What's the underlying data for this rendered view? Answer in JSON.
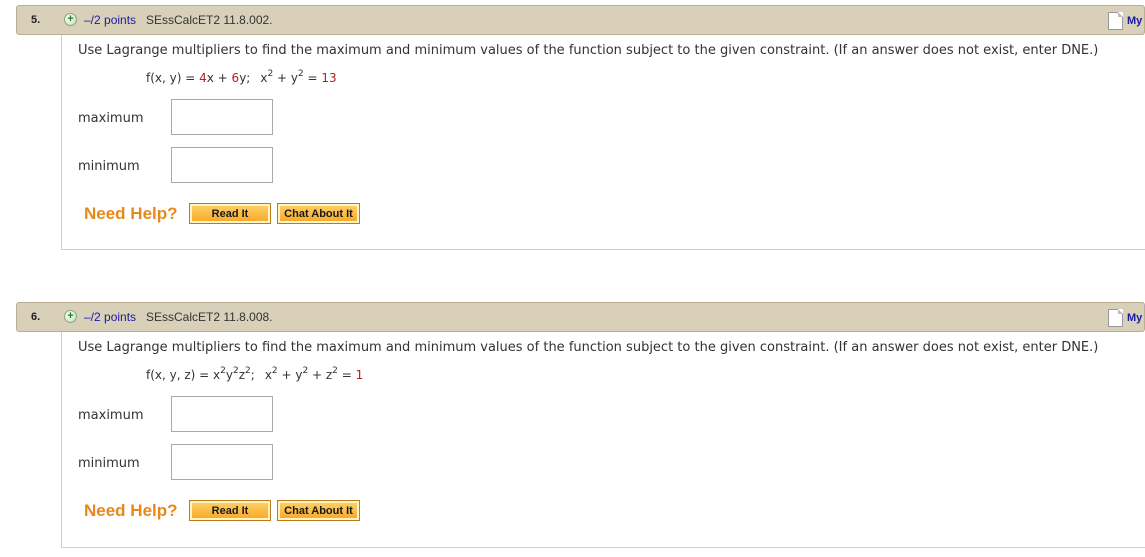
{
  "questions": [
    {
      "number": "5.",
      "points": "–/2 points",
      "code": "SEssCalcET2 11.8.002.",
      "notes_label": "My",
      "prompt": "Use Lagrange multipliers to find the maximum and minimum values of the function subject to the given constraint. (If an answer does not exist, enter DNE.)",
      "function": {
        "lhs": "f(x, y) = ",
        "parts": [
          {
            "text": "4",
            "style": "num"
          },
          {
            "text": "x + ",
            "style": "plain"
          },
          {
            "text": "6",
            "style": "num"
          },
          {
            "text": "y;",
            "style": "plain"
          }
        ]
      },
      "constraint": {
        "parts": [
          {
            "text": "x",
            "style": "plain"
          },
          {
            "text": "2",
            "style": "sup"
          },
          {
            "text": " + y",
            "style": "plain"
          },
          {
            "text": "2",
            "style": "sup"
          },
          {
            "text": " = ",
            "style": "plain"
          },
          {
            "text": "13",
            "style": "num"
          }
        ]
      },
      "maximum_label": "maximum",
      "minimum_label": "minimum",
      "maximum_value": "",
      "minimum_value": "",
      "need_help": "Need Help?",
      "read_it": "Read It",
      "chat_about_it": "Chat About It"
    },
    {
      "number": "6.",
      "points": "–/2 points",
      "code": "SEssCalcET2 11.8.008.",
      "notes_label": "My",
      "prompt": "Use Lagrange multipliers to find the maximum and minimum values of the function subject to the given constraint. (If an answer does not exist, enter DNE.)",
      "function": {
        "lhs": "f(x, y, z) = ",
        "parts": [
          {
            "text": "x",
            "style": "plain"
          },
          {
            "text": "2",
            "style": "sup"
          },
          {
            "text": "y",
            "style": "plain"
          },
          {
            "text": "2",
            "style": "sup"
          },
          {
            "text": "z",
            "style": "plain"
          },
          {
            "text": "2",
            "style": "sup"
          },
          {
            "text": ";",
            "style": "plain"
          }
        ]
      },
      "constraint": {
        "parts": [
          {
            "text": "x",
            "style": "plain"
          },
          {
            "text": "2",
            "style": "sup"
          },
          {
            "text": " + y",
            "style": "plain"
          },
          {
            "text": "2",
            "style": "sup"
          },
          {
            "text": " + z",
            "style": "plain"
          },
          {
            "text": "2",
            "style": "sup"
          },
          {
            "text": " = ",
            "style": "plain"
          },
          {
            "text": "1",
            "style": "num"
          }
        ]
      },
      "maximum_label": "maximum",
      "minimum_label": "minimum",
      "maximum_value": "",
      "minimum_value": "",
      "need_help": "Need Help?",
      "read_it": "Read It",
      "chat_about_it": "Chat About It"
    }
  ],
  "colors": {
    "header_bg": "#d8d0b8",
    "points_link": "#1a1aa6",
    "need_help": "#e8881a",
    "constant_red": "#b22020",
    "button_orange": "#f6a623"
  },
  "icons": {
    "expand": "plus-circle-icon",
    "notes": "notes-page-icon"
  }
}
